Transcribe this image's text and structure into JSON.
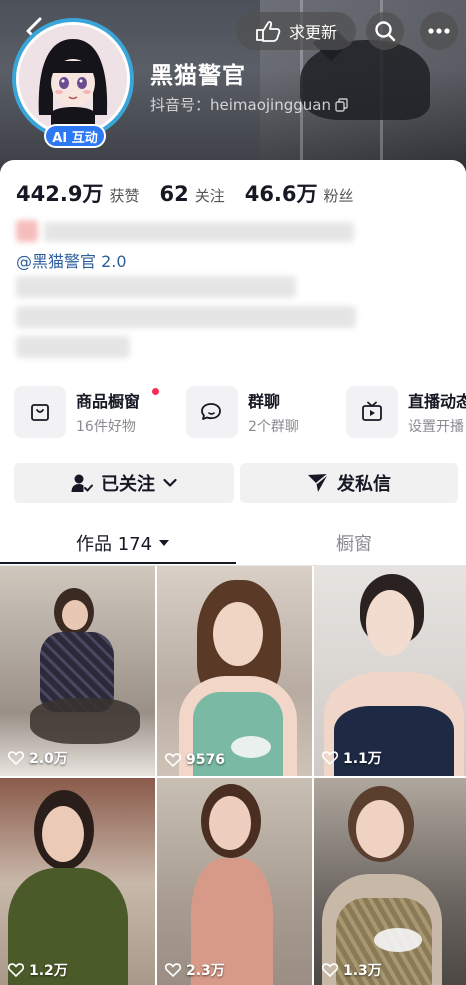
{
  "header": {
    "follow_update_label": "求更新",
    "username": "黑猫警官",
    "douyin_id": "抖音号：heimaojingguan",
    "ai_badge": "AI 互动"
  },
  "stats": [
    {
      "value": "442.9万",
      "label": "获赞"
    },
    {
      "value": "62",
      "label": "关注"
    },
    {
      "value": "46.6万",
      "label": "粉丝"
    }
  ],
  "bio": {
    "mention": "@黑猫警官 2.0"
  },
  "features": [
    {
      "title": "商品橱窗",
      "subtitle": "16件好物",
      "icon": "bag-icon"
    },
    {
      "title": "群聊",
      "subtitle": "2个群聊",
      "icon": "chat-icon"
    },
    {
      "title": "直播动态",
      "subtitle": "设置开播",
      "icon": "tv-icon"
    }
  ],
  "actions": {
    "followed_label": "已关注",
    "message_label": "发私信"
  },
  "tabs": {
    "works_label": "作品 174",
    "shop_label": "橱窗"
  },
  "videos": [
    {
      "likes": "2.0万"
    },
    {
      "likes": "9576"
    },
    {
      "likes": "1.1万"
    },
    {
      "likes": "1.2万"
    },
    {
      "likes": "2.3万"
    },
    {
      "likes": "1.3万"
    }
  ],
  "colors": {
    "accent_blue": "#2d78f4",
    "notification_red": "#fe2c55",
    "mention_blue": "#2c5e9e"
  }
}
